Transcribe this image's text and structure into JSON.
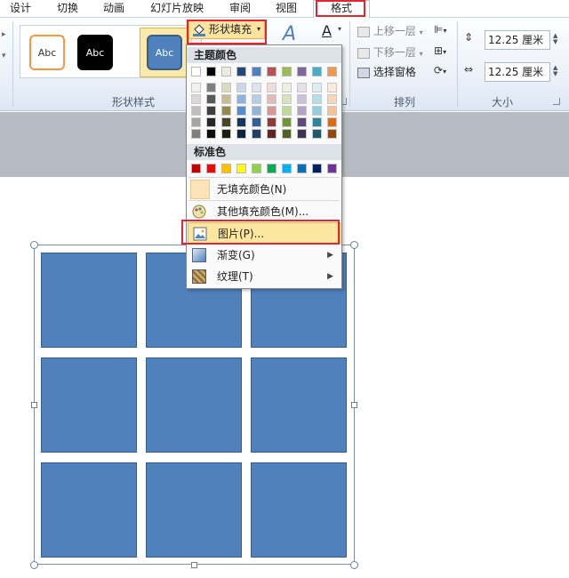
{
  "tabs": [
    {
      "label": "设计"
    },
    {
      "label": "切换"
    },
    {
      "label": "动画"
    },
    {
      "label": "幻灯片放映"
    },
    {
      "label": "审阅"
    },
    {
      "label": "视图"
    },
    {
      "label": "格式"
    }
  ],
  "ribbon": {
    "shape_styles": {
      "group_label": "形状样式",
      "presets": [
        {
          "text": "Abc",
          "fill": "#ffffff",
          "border": "#f79646",
          "color": "#333333"
        },
        {
          "text": "Abc",
          "fill": "#000000",
          "border": "#000000",
          "color": "#ffffff"
        },
        {
          "text": "Abc",
          "fill": "#4f81bd",
          "border": "#385d8a",
          "color": "#ffffff"
        }
      ],
      "shape_fill_label": "形状填充"
    },
    "arrange": {
      "group_label": "排列",
      "bring_forward": "上移一层",
      "send_backward": "下移一层",
      "selection_pane": "选择窗格"
    },
    "size": {
      "group_label": "大小",
      "height_value": "12.25 厘米",
      "width_value": "12.25 厘米"
    }
  },
  "fill_menu": {
    "theme_colors_title": "主题颜色",
    "theme_top_row": [
      "#ffffff",
      "#000000",
      "#eeece1",
      "#1f497d",
      "#4f81bd",
      "#c0504d",
      "#9bbb59",
      "#8064a2",
      "#4bacc6",
      "#f79646"
    ],
    "theme_shades": [
      [
        "#f2f2f2",
        "#7f7f7f",
        "#ddd9c3",
        "#c6d9f0",
        "#dbe5f1",
        "#f2dcdb",
        "#ebf1dd",
        "#e5e0ec",
        "#dbeef3",
        "#fdeada"
      ],
      [
        "#d8d8d8",
        "#595959",
        "#c4bd97",
        "#8db3e2",
        "#b8cce4",
        "#e5b9b7",
        "#d7e3bc",
        "#ccc1d9",
        "#b7dde8",
        "#fbd5b5"
      ],
      [
        "#bfbfbf",
        "#3f3f3f",
        "#938953",
        "#548dd4",
        "#95b3d7",
        "#d99694",
        "#c3d69b",
        "#b2a2c7",
        "#92cddc",
        "#fac08f"
      ],
      [
        "#a5a5a5",
        "#262626",
        "#494429",
        "#17365d",
        "#366092",
        "#953734",
        "#76923c",
        "#5f497a",
        "#31859b",
        "#e36c09"
      ],
      [
        "#7f7f7f",
        "#0c0c0c",
        "#1d1b10",
        "#0f243e",
        "#244061",
        "#632423",
        "#4f6128",
        "#3f3151",
        "#205867",
        "#974806"
      ]
    ],
    "standard_colors_title": "标准色",
    "standard_colors": [
      "#c00000",
      "#ff0000",
      "#ffc000",
      "#ffff00",
      "#92d050",
      "#00b050",
      "#00b0f0",
      "#0070c0",
      "#002060",
      "#7030a0"
    ],
    "items": {
      "no_fill": "无填充颜色(N)",
      "more_colors": "其他填充颜色(M)...",
      "picture": "图片(P)...",
      "gradient": "渐变(G)",
      "texture": "纹理(T)"
    }
  },
  "accent_colors": {
    "highlight": "#e3262d",
    "shape_fill": "#4f81bd"
  }
}
